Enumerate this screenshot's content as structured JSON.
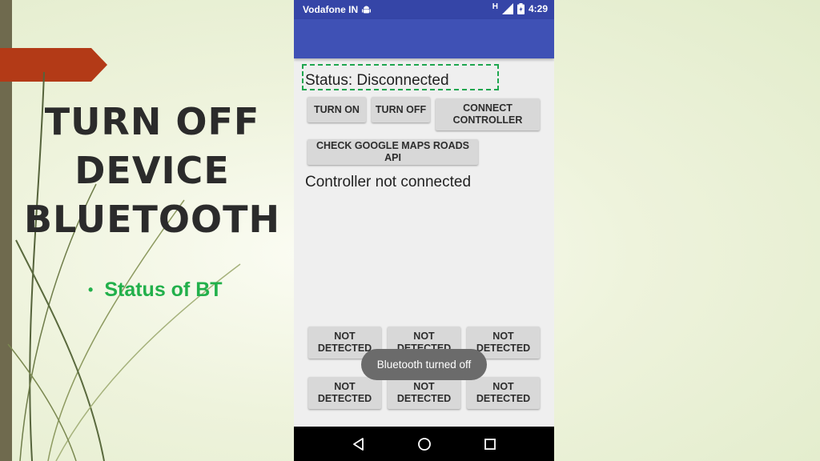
{
  "slide": {
    "title_lines": [
      "TURN OFF",
      "DEVICE",
      "BLUETOOTH"
    ],
    "bullet": "Status of BT"
  },
  "phone": {
    "status_bar": {
      "carrier": "Vodafone IN",
      "network": "H",
      "time": "4:29"
    },
    "status_label": "Status: Disconnected",
    "buttons": {
      "turn_on": "TURN ON",
      "turn_off": "TURN OFF",
      "connect_controller": [
        "CONNECT",
        "CONTROLLER"
      ],
      "check_maps": "CHECK GOOGLE MAPS ROADS API"
    },
    "controller_text": "Controller not connected",
    "grid": [
      [
        "NOT",
        "DETECTED"
      ],
      [
        "NOT",
        "DETECTED"
      ],
      [
        "NOT",
        "DETECTED"
      ],
      [
        "NOT",
        "DETECTED"
      ],
      [
        "NOT",
        "DETECTED"
      ],
      [
        "NOT",
        "DETECTED"
      ]
    ],
    "toast": "Bluetooth turned off",
    "nav_icons": [
      "back-icon",
      "home-icon",
      "recents-icon"
    ]
  },
  "colors": {
    "accent": "#3f51b5",
    "status_bar": "#3545a7",
    "bullet": "#22b04b",
    "tab": "#b33a17"
  }
}
